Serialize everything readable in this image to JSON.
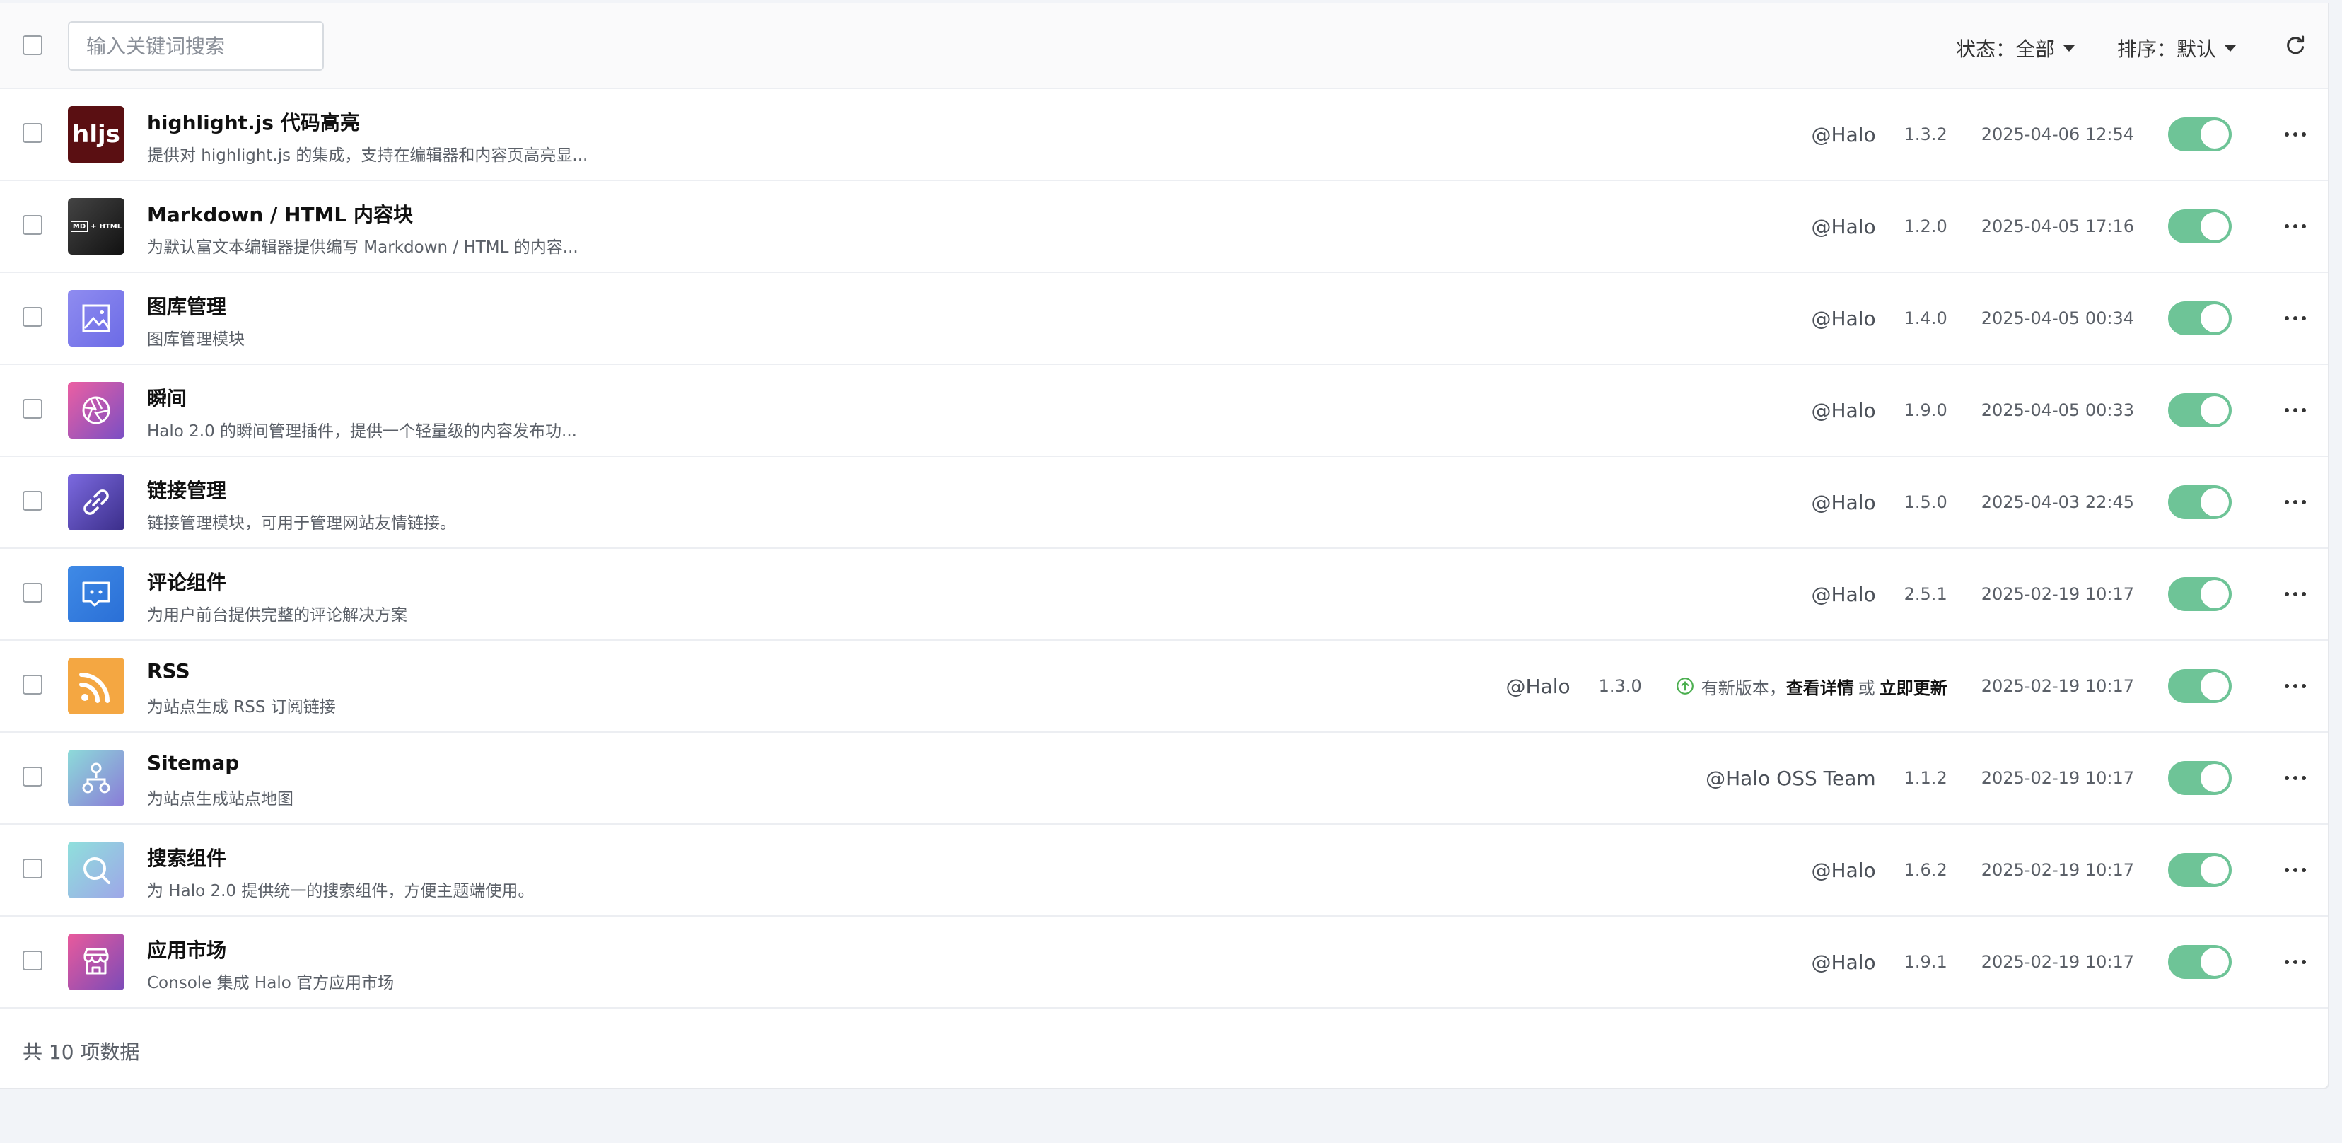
{
  "toolbar": {
    "search_placeholder": "输入关键词搜索",
    "status_label": "状态：",
    "status_value": "全部",
    "sort_label": "排序：",
    "sort_value": "默认"
  },
  "colors": {
    "toggle_on": "#6ec497",
    "accent": "#4caf50"
  },
  "plugins": [
    {
      "title": "highlight.js 代码高亮",
      "desc": "提供对 highlight.js 的集成，支持在编辑器和内容页高亮显...",
      "author": "@Halo",
      "version": "1.3.2",
      "date": "2025-04-06 12:54",
      "enabled": true,
      "icon": "hljs-logo-icon"
    },
    {
      "title": "Markdown / HTML 内容块",
      "desc": "为默认富文本编辑器提供编写 Markdown / HTML 的内容...",
      "author": "@Halo",
      "version": "1.2.0",
      "date": "2025-04-05 17:16",
      "enabled": true,
      "icon": "markdown-html-logo-icon"
    },
    {
      "title": "图库管理",
      "desc": "图库管理模块",
      "author": "@Halo",
      "version": "1.4.0",
      "date": "2025-04-05 00:34",
      "enabled": true,
      "icon": "image-gallery-icon"
    },
    {
      "title": "瞬间",
      "desc": "Halo 2.0 的瞬间管理插件，提供一个轻量级的内容发布功...",
      "author": "@Halo",
      "version": "1.9.0",
      "date": "2025-04-05 00:33",
      "enabled": true,
      "icon": "moments-icon"
    },
    {
      "title": "链接管理",
      "desc": "链接管理模块，可用于管理网站友情链接。",
      "author": "@Halo",
      "version": "1.5.0",
      "date": "2025-04-03 22:45",
      "enabled": true,
      "icon": "link-icon"
    },
    {
      "title": "评论组件",
      "desc": "为用户前台提供完整的评论解决方案",
      "author": "@Halo",
      "version": "2.5.1",
      "date": "2025-02-19 10:17",
      "enabled": true,
      "icon": "comment-icon"
    },
    {
      "title": "RSS",
      "desc": "为站点生成 RSS 订阅链接",
      "author": "@Halo",
      "version": "1.3.0",
      "date": "2025-02-19 10:17",
      "enabled": true,
      "icon": "rss-icon",
      "update": {
        "text": "有新版本，",
        "details": "查看详情",
        "or": "或",
        "update_now": "立即更新"
      }
    },
    {
      "title": "Sitemap",
      "desc": "为站点生成站点地图",
      "author": "@Halo OSS Team",
      "version": "1.1.2",
      "date": "2025-02-19 10:17",
      "enabled": true,
      "icon": "sitemap-icon"
    },
    {
      "title": "搜索组件",
      "desc": "为 Halo 2.0 提供统一的搜索组件，方便主题端使用。",
      "author": "@Halo",
      "version": "1.6.2",
      "date": "2025-02-19 10:17",
      "enabled": true,
      "icon": "search-icon"
    },
    {
      "title": "应用市场",
      "desc": "Console 集成 Halo 官方应用市场",
      "author": "@Halo",
      "version": "1.9.1",
      "date": "2025-02-19 10:17",
      "enabled": true,
      "icon": "app-store-icon"
    }
  ],
  "footer": {
    "total_text": "共 10 项数据"
  },
  "logo_text": {
    "hljs": "hljs",
    "md": "MD",
    "html": "HTML"
  }
}
